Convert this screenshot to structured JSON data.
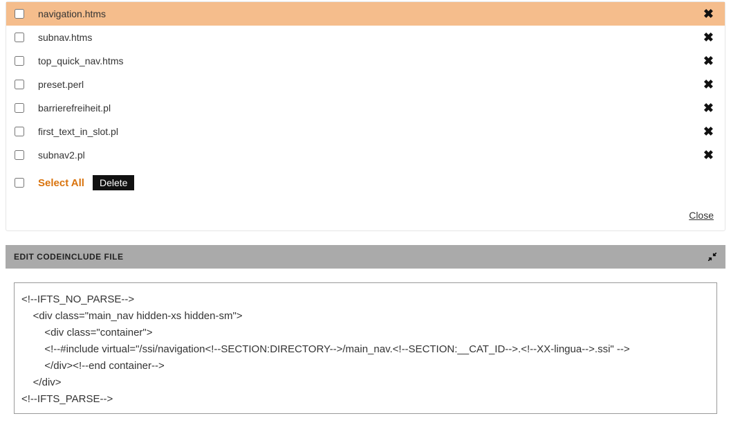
{
  "files": [
    {
      "name": "navigation.htms",
      "highlight": true
    },
    {
      "name": "subnav.htms",
      "highlight": false
    },
    {
      "name": "top_quick_nav.htms",
      "highlight": false
    },
    {
      "name": "preset.perl",
      "highlight": false
    },
    {
      "name": "barrierefreiheit.pl",
      "highlight": false
    },
    {
      "name": "first_text_in_slot.pl",
      "highlight": false
    },
    {
      "name": "subnav2.pl",
      "highlight": false
    }
  ],
  "actions": {
    "select_all": "Select All",
    "delete": "Delete"
  },
  "footer": {
    "close": "Close"
  },
  "editor": {
    "title": "EDIT CODEINCLUDE FILE",
    "content": "<!--IFTS_NO_PARSE-->\n    <div class=\"main_nav hidden-xs hidden-sm\">\n        <div class=\"container\">\n        <!--#include virtual=\"/ssi/navigation<!--SECTION:DIRECTORY-->/main_nav.<!--SECTION:__CAT_ID-->.<!--XX-lingua-->.ssi\" -->\n        </div><!--end container-->\n    </div>\n<!--IFTS_PARSE-->"
  }
}
